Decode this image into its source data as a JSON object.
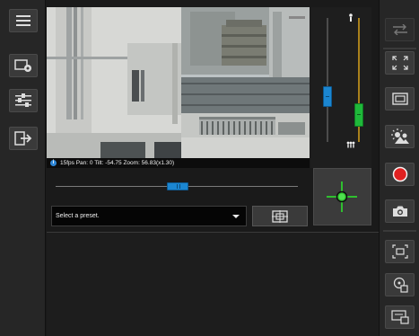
{
  "colors": {
    "accent_blue": "#1b86d1",
    "zoom_green": "#1fb83a",
    "tilt_bar_yellow": "#d9a21c",
    "record_red": "#e02020",
    "crosshair_green": "#2fbf2f"
  },
  "left_toolbar": {
    "items": [
      {
        "name": "menu-button",
        "icon": "hamburger-menu-icon"
      },
      {
        "name": "camera-settings-button",
        "icon": "camera-settings-icon"
      },
      {
        "name": "view-settings-button",
        "icon": "sliders-icon"
      },
      {
        "name": "logout-button",
        "icon": "exit-icon"
      }
    ]
  },
  "video": {
    "status_text": "15fps Pan: 0 Tilt: -54.75 Zoom: 56.83(x1.30)"
  },
  "ptz": {
    "tilt_level_percent": 38,
    "zoom_level_percent": 31,
    "pan_level_percent": 50
  },
  "preset": {
    "selected": "Select a preset."
  },
  "right_toolbar": {
    "items": [
      {
        "name": "swap-button",
        "icon": "swap-arrows-icon"
      },
      {
        "name": "fullscreen-button",
        "icon": "fullscreen-icon"
      },
      {
        "name": "view-size-button",
        "icon": "window-icon"
      },
      {
        "name": "day-night-button",
        "icon": "day-night-icon"
      },
      {
        "name": "record-button",
        "icon": "record-icon"
      },
      {
        "name": "snapshot-button",
        "icon": "camera-icon"
      },
      {
        "name": "digital-zoom-button",
        "icon": "digital-zoom-icon"
      },
      {
        "name": "touch-ptz-button",
        "icon": "touch-icon"
      },
      {
        "name": "screen-capture-button",
        "icon": "screen-capture-icon"
      }
    ]
  }
}
